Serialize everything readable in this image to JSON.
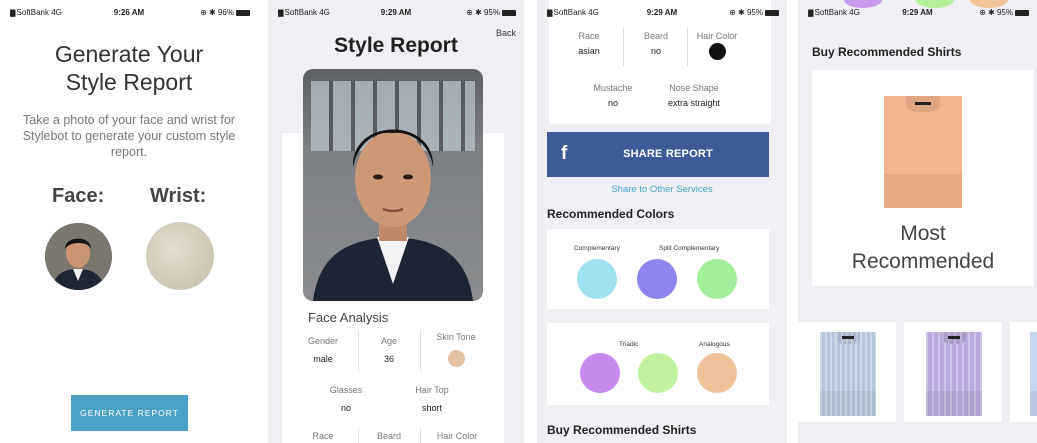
{
  "screen1": {
    "status": {
      "carrier": "SoftBank",
      "network": "4G",
      "time": "9:26 AM",
      "battery": "96%"
    },
    "title_line1": "Generate Your",
    "title_line2": "Style Report",
    "description": "Take a photo of your face and wrist for Stylebot to generate your custom style report.",
    "face_label": "Face:",
    "wrist_label": "Wrist:",
    "generate_button": "GENERATE REPORT",
    "colors": {
      "button": "#4aa3c6"
    }
  },
  "screen2": {
    "status": {
      "carrier": "SoftBank",
      "network": "4G",
      "time": "9:29 AM",
      "battery": "95%"
    },
    "title": "Style Report",
    "back": "Back",
    "section": "Face Analysis",
    "gender": {
      "label": "Gender",
      "value": "male"
    },
    "age": {
      "label": "Age",
      "value": "36"
    },
    "skin_tone": {
      "label": "Skin Tone",
      "color": "#e3c2a6"
    },
    "glasses": {
      "label": "Glasses",
      "value": "no"
    },
    "hair_top": {
      "label": "Hair Top",
      "value": "short"
    },
    "race": {
      "label": "Race"
    },
    "beard": {
      "label": "Beard"
    },
    "hair_color": {
      "label": "Hair Color"
    }
  },
  "screen3": {
    "status": {
      "carrier": "SoftBank",
      "network": "4G",
      "time": "9:29 AM",
      "battery": "95%"
    },
    "race": {
      "label": "Race",
      "value": "asian"
    },
    "beard": {
      "label": "Beard",
      "value": "no"
    },
    "hair_color": {
      "label": "Hair Color",
      "color": "#111111"
    },
    "mustache": {
      "label": "Mustache",
      "value": "no"
    },
    "nose_shape": {
      "label": "Nose Shape",
      "value": "extra straight"
    },
    "share_icon": "f",
    "share_button": "SHARE REPORT",
    "share_link": "Share to Other Services",
    "recommended_colors": "Recommended Colors",
    "complementary": {
      "label": "Complementary",
      "color": "#a0e2ef"
    },
    "split_complementary": {
      "label": "Split Complementary",
      "colors": [
        "#8e86ee",
        "#a3ee9a"
      ]
    },
    "triadic": {
      "label": "Triadic",
      "colors": [
        "#c48af0",
        "#c2f2a0"
      ]
    },
    "analogous": {
      "label": "Analogous",
      "color": "#efc29a"
    },
    "buy_header": "Buy Recommended Shirts",
    "colors": {
      "facebook": "#3e5a99",
      "link": "#4aa3c6"
    }
  },
  "screen4": {
    "status": {
      "carrier": "SoftBank",
      "network": "4G",
      "time": "9:29 AM",
      "battery": "95%"
    },
    "title": "Buy Recommended Shirts",
    "most_line1": "Most",
    "most_line2": "Recommended",
    "main_shirt_color": "#f2b48c",
    "thumb_colors": [
      "#b7c6dd",
      "#b9a9dc",
      "#c8d6ee"
    ],
    "blob_colors": [
      "#c79bef",
      "#b8ef9a",
      "#f1c79a"
    ]
  }
}
